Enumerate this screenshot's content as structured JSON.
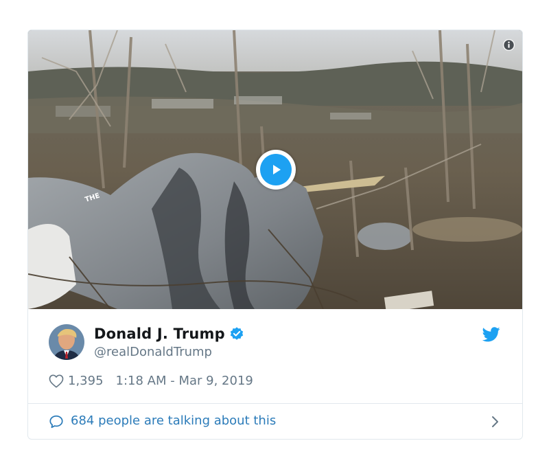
{
  "tweet": {
    "author": {
      "name": "Donald J. Trump",
      "handle": "@realDonaldTrump",
      "verified": true
    },
    "likes": "1,395",
    "timestamp": "1:18 AM - Mar 9, 2019",
    "talking_text": "684 people are talking about this",
    "media": {
      "type": "video",
      "play_icon": "play-icon",
      "info_icon": "info-icon",
      "tarp_print": "THE"
    }
  },
  "colors": {
    "accent": "#1da1f2",
    "name": "#14171a",
    "secondary": "#657786",
    "link": "#2b7bb9",
    "border": "#e1e8ed"
  },
  "icons": {
    "verified": "verified-badge-icon",
    "bird": "twitter-bird-icon",
    "heart": "heart-icon",
    "bubble": "speech-bubble-icon",
    "chevron": "chevron-right-icon"
  }
}
